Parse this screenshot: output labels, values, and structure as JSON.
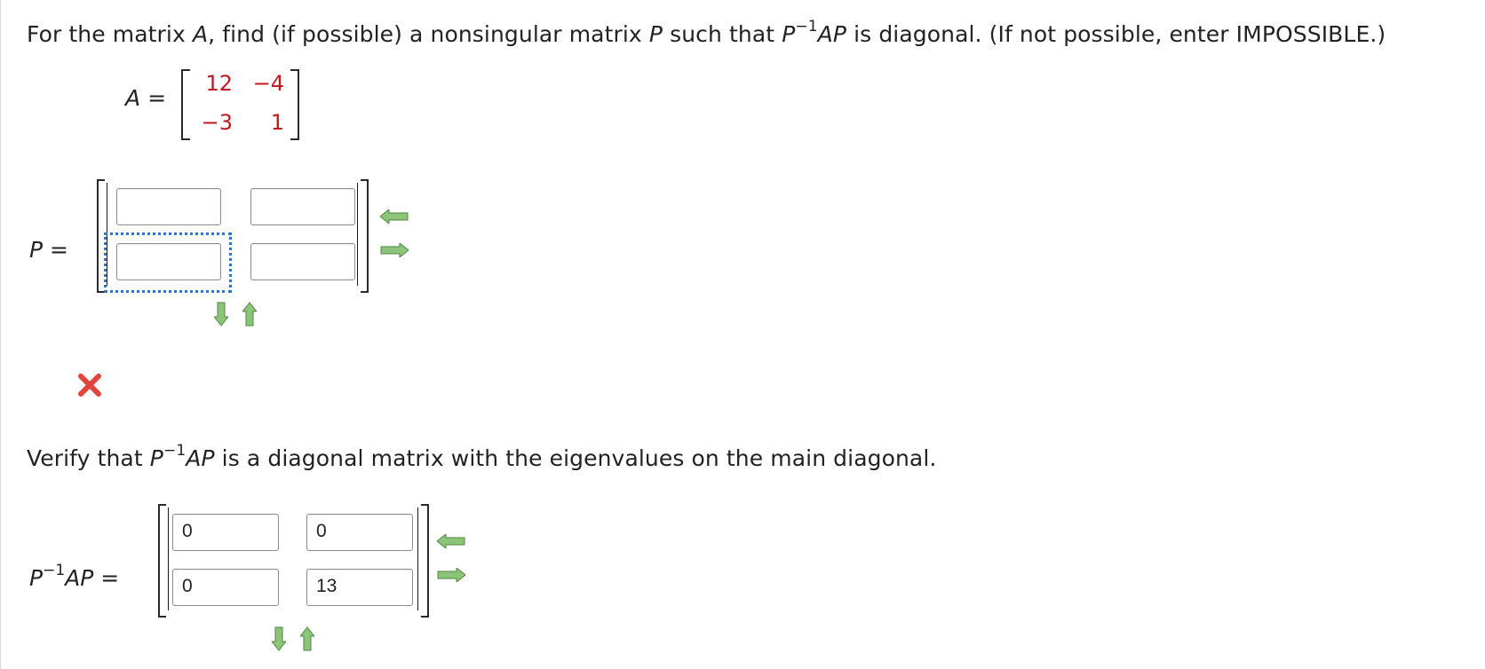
{
  "question": {
    "prefix": "For the matrix ",
    "A": "A",
    "mid1": ", find (if possible) a nonsingular matrix ",
    "P": "P",
    "mid2": " such that ",
    "Pinv": "P",
    "sup": "−1",
    "AP": "AP",
    "suffix": " is diagonal. (If not possible, enter IMPOSSIBLE.)"
  },
  "matrix_A": {
    "label": "A",
    "equals": "=",
    "r1c1": "12",
    "r1c2": "−4",
    "r2c1": "−3",
    "r2c2": "1"
  },
  "matrix_P": {
    "label": "P",
    "equals": "=",
    "values": [
      "",
      "",
      "",
      ""
    ]
  },
  "status": {
    "icon": "incorrect-x-icon",
    "color": "#e0463d"
  },
  "verify": {
    "prefix": "Verify that ",
    "P": "P",
    "sup": "−1",
    "AP": "AP",
    "suffix": " is a diagonal matrix with the eigenvalues on the main diagonal."
  },
  "matrix_D": {
    "label_P": "P",
    "label_sup": "−1",
    "label_AP": "AP",
    "equals": "=",
    "values": [
      "0",
      "0",
      "0",
      "13"
    ]
  },
  "icons": {
    "add_column": "arrow-left-icon",
    "remove_column": "arrow-right-icon",
    "add_row": "arrow-down-icon",
    "remove_row": "arrow-up-icon",
    "arrow_color": "#5c9a4e"
  }
}
